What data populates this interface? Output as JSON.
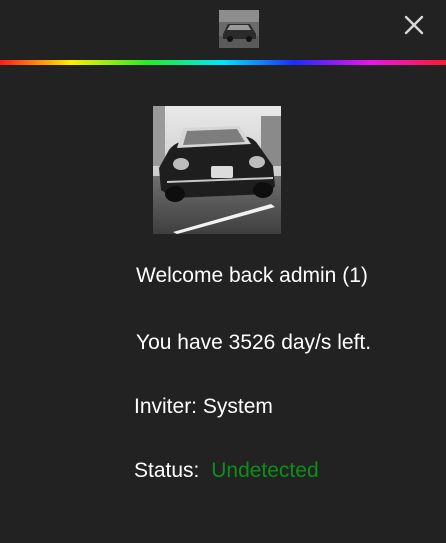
{
  "colors": {
    "background": "#222222",
    "text": "#ffffff",
    "status_ok": "#0a8f1a",
    "close_icon": "#d8d8d8",
    "rainbow": [
      "#ff0000",
      "#ffff00",
      "#00ff00",
      "#00ffff",
      "#0000ff",
      "#ff00ff",
      "#ff0000"
    ]
  },
  "titlebar": {
    "logo_icon": "car-photo-icon",
    "close_icon": "close-icon"
  },
  "profile": {
    "avatar_icon": "car-photo-avatar"
  },
  "welcome_text": "Welcome back admin (1)",
  "days_text": "You have 3526 day/s left.",
  "inviter_text": "Inviter: System",
  "status": {
    "label": "Status:",
    "value": "Undetected",
    "value_color": "#0a8f1a"
  }
}
